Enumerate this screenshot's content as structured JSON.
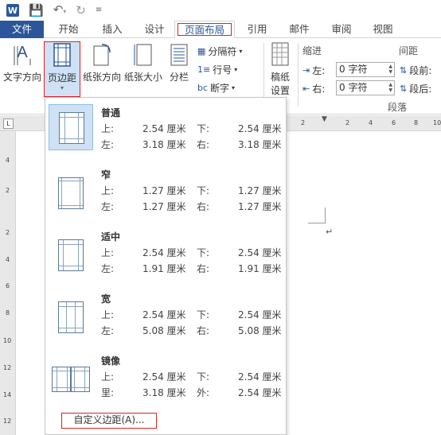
{
  "qat": {
    "logo": "W",
    "save_icon": "save-icon",
    "undo_icon": "undo-icon",
    "redo_icon": "redo-icon",
    "customize_icon": "customize-icon"
  },
  "tabs": [
    {
      "label": "文件"
    },
    {
      "label": "开始"
    },
    {
      "label": "插入"
    },
    {
      "label": "设计"
    },
    {
      "label": "页面布局"
    },
    {
      "label": "引用"
    },
    {
      "label": "邮件"
    },
    {
      "label": "审阅"
    },
    {
      "label": "视图"
    }
  ],
  "ribbon": {
    "text_direction": "文字方向",
    "margins": "页边距",
    "orientation": "纸张方向",
    "size": "纸张大小",
    "columns": "分栏",
    "breaks": "分隔符",
    "line_numbers": "行号",
    "hyphenation": "断字",
    "draft_settings": [
      "稿纸",
      "设置"
    ],
    "indent_label": "缩进",
    "spacing_label": "间距",
    "indent_left_label": "左:",
    "indent_right_label": "右:",
    "indent_left_value": "0 字符",
    "indent_right_value": "0 字符",
    "spacing_before_label": "段前:",
    "spacing_after_label": "段后:",
    "paragraph_group": "段落"
  },
  "ruler": {
    "h_ticks": [
      "2",
      "2",
      "4",
      "6",
      "8",
      "10"
    ],
    "v_ticks": [
      "4",
      "2",
      "2",
      "4",
      "6",
      "8",
      "10",
      "12",
      "14",
      "16",
      "18",
      "12"
    ],
    "corner": "L"
  },
  "margins_menu": {
    "presets": [
      {
        "name": "普通",
        "r1": [
          "上:",
          "2.54 厘米",
          "下:",
          "2.54 厘米"
        ],
        "r2": [
          "左:",
          "3.18 厘米",
          "右:",
          "3.18 厘米"
        ]
      },
      {
        "name": "窄",
        "r1": [
          "上:",
          "1.27 厘米",
          "下:",
          "1.27 厘米"
        ],
        "r2": [
          "左:",
          "1.27 厘米",
          "右:",
          "1.27 厘米"
        ]
      },
      {
        "name": "适中",
        "r1": [
          "上:",
          "2.54 厘米",
          "下:",
          "2.54 厘米"
        ],
        "r2": [
          "左:",
          "1.91 厘米",
          "右:",
          "1.91 厘米"
        ]
      },
      {
        "name": "宽",
        "r1": [
          "上:",
          "2.54 厘米",
          "下:",
          "2.54 厘米"
        ],
        "r2": [
          "左:",
          "5.08 厘米",
          "右:",
          "5.08 厘米"
        ]
      },
      {
        "name": "镜像",
        "r1": [
          "上:",
          "2.54 厘米",
          "下:",
          "2.54 厘米"
        ],
        "r2": [
          "里:",
          "3.18 厘米",
          "外:",
          "2.54 厘米"
        ]
      }
    ],
    "custom_label": "自定义边距(A)..."
  },
  "document": {
    "paragraph_mark": "↵"
  },
  "colors": {
    "accent": "#2b579a",
    "highlight_border": "#e0201f",
    "selection_fill": "#cfe2f5"
  }
}
